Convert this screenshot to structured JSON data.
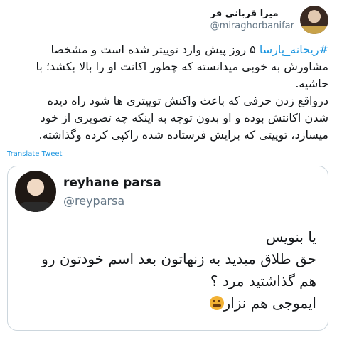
{
  "tweet": {
    "author": {
      "display_name": "میرا قربانی فر",
      "handle": "@miraghorbanifar"
    },
    "hashtag": "#ریحانه_پارسا",
    "text_line1_rest": " ۵ روز پیش وارد توییتر شده است و مشخصا",
    "text_line2": "مشاورش به خوبی میدانسته که چطور اکانت او را بالا بکشد؛ با",
    "text_line3": "حاشیه.",
    "text_line4": "درواقع زدن حرفی که باعث واکنش توییتری ها شود راه دیده",
    "text_line5": "شدن اکانتش بوده و او بدون توجه به اینکه چه تصویری از خود",
    "text_line6": "میسازد، توییتی که برایش فرستاده شده راکپی کرده وگذاشته.",
    "translate_label": "Translate Tweet"
  },
  "quoted_tweet": {
    "display_name": "reyhane parsa",
    "handle": "@reyparsa",
    "line1": "یا بنویس",
    "line2": "حق طلاق میدید به زنهاتون بعد اسم خودتون رو",
    "line3": "هم گذاشتید مرد ؟",
    "line4": "ایموجی هم نزار",
    "emoji_icon": "tired-face-emoji-icon"
  }
}
